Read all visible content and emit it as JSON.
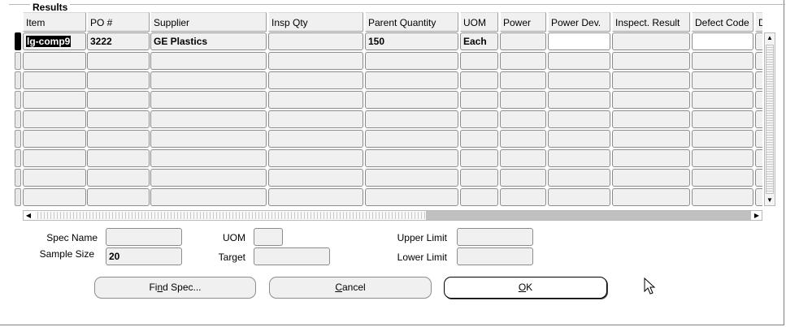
{
  "region_title": "Results",
  "columns": [
    "Item",
    "PO #",
    "Supplier",
    "Insp Qty",
    "Parent Quantity",
    "UOM",
    "Power",
    "Power Dev.",
    "Inspect. Result",
    "Defect Code",
    "D"
  ],
  "rows": [
    {
      "item": "lg-comp9",
      "po": "3222",
      "supplier": "GE Plastics",
      "insp_qty": "",
      "parent_qty": "150",
      "uom": "Each",
      "power": "",
      "power_dev": "",
      "inspect_result": "",
      "defect_code": "",
      "d": ""
    },
    {
      "item": "",
      "po": "",
      "supplier": "",
      "insp_qty": "",
      "parent_qty": "",
      "uom": "",
      "power": "",
      "power_dev": "",
      "inspect_result": "",
      "defect_code": "",
      "d": ""
    },
    {
      "item": "",
      "po": "",
      "supplier": "",
      "insp_qty": "",
      "parent_qty": "",
      "uom": "",
      "power": "",
      "power_dev": "",
      "inspect_result": "",
      "defect_code": "",
      "d": ""
    },
    {
      "item": "",
      "po": "",
      "supplier": "",
      "insp_qty": "",
      "parent_qty": "",
      "uom": "",
      "power": "",
      "power_dev": "",
      "inspect_result": "",
      "defect_code": "",
      "d": ""
    },
    {
      "item": "",
      "po": "",
      "supplier": "",
      "insp_qty": "",
      "parent_qty": "",
      "uom": "",
      "power": "",
      "power_dev": "",
      "inspect_result": "",
      "defect_code": "",
      "d": ""
    },
    {
      "item": "",
      "po": "",
      "supplier": "",
      "insp_qty": "",
      "parent_qty": "",
      "uom": "",
      "power": "",
      "power_dev": "",
      "inspect_result": "",
      "defect_code": "",
      "d": ""
    },
    {
      "item": "",
      "po": "",
      "supplier": "",
      "insp_qty": "",
      "parent_qty": "",
      "uom": "",
      "power": "",
      "power_dev": "",
      "inspect_result": "",
      "defect_code": "",
      "d": ""
    },
    {
      "item": "",
      "po": "",
      "supplier": "",
      "insp_qty": "",
      "parent_qty": "",
      "uom": "",
      "power": "",
      "power_dev": "",
      "inspect_result": "",
      "defect_code": "",
      "d": ""
    },
    {
      "item": "",
      "po": "",
      "supplier": "",
      "insp_qty": "",
      "parent_qty": "",
      "uom": "",
      "power": "",
      "power_dev": "",
      "inspect_result": "",
      "defect_code": "",
      "d": ""
    }
  ],
  "spec": {
    "spec_name_label": "Spec Name",
    "spec_name_value": "",
    "sample_size_label": "Sample Size",
    "sample_size_value": "20",
    "uom_label": "UOM",
    "uom_value": "",
    "target_label": "Target",
    "target_value": "",
    "upper_limit_label": "Upper Limit",
    "upper_limit_value": "",
    "lower_limit_label": "Lower Limit",
    "lower_limit_value": ""
  },
  "buttons": {
    "find_spec_pre": "Fi",
    "find_spec_key": "n",
    "find_spec_post": "d Spec...",
    "cancel_key": "C",
    "cancel_post": "ancel",
    "ok_key": "O",
    "ok_post": "K"
  }
}
